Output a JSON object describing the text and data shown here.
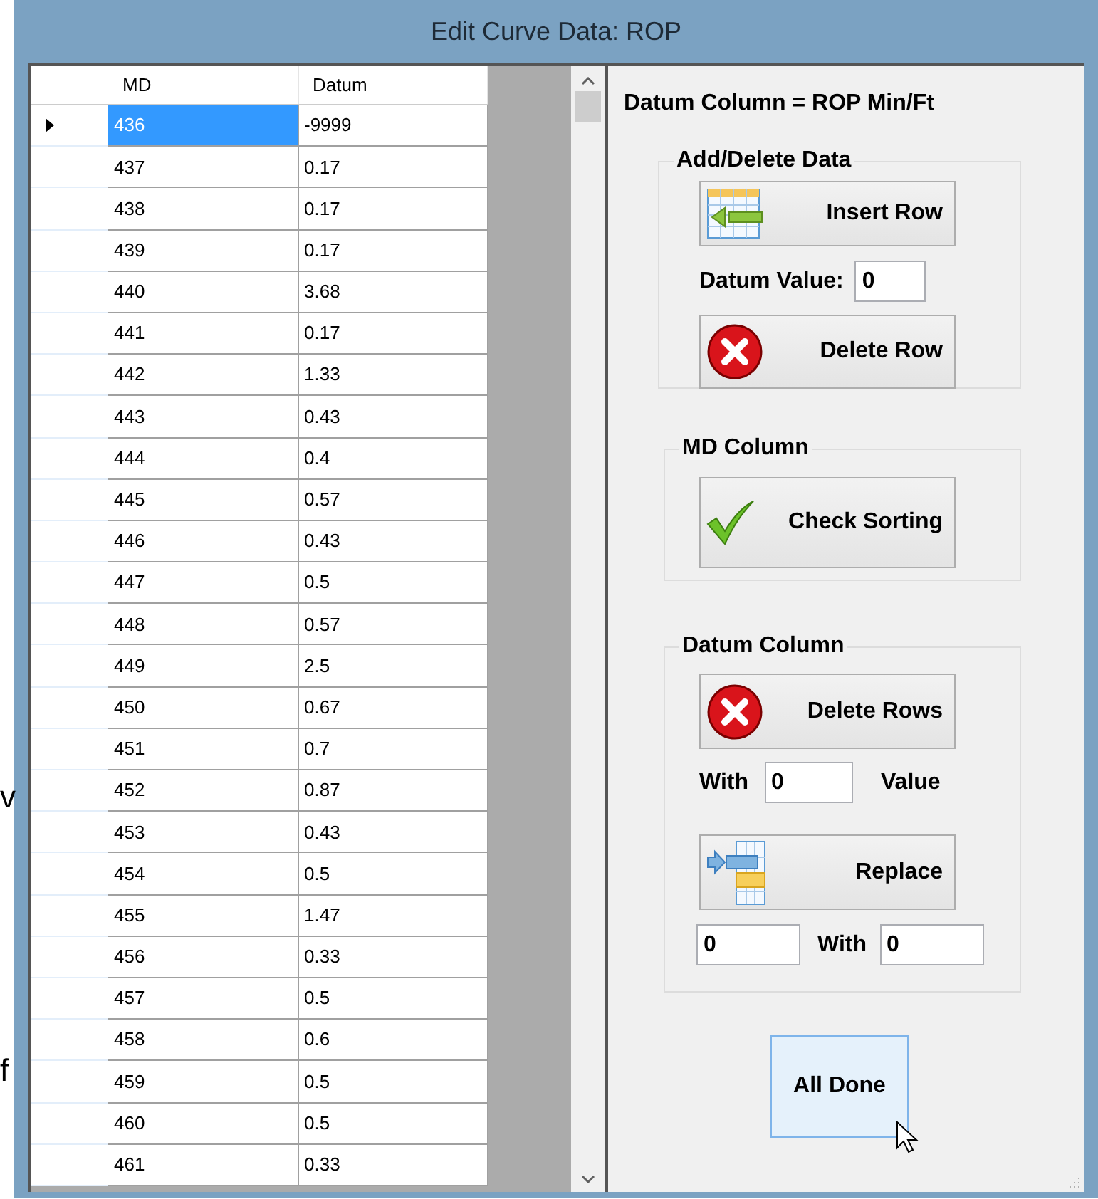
{
  "background_text": [
    "v",
    "f"
  ],
  "window": {
    "title": "Edit Curve Data: ROP"
  },
  "grid": {
    "columns": [
      "MD",
      "Datum"
    ],
    "rows": [
      {
        "md": "436",
        "datum": "-9999",
        "selected": true
      },
      {
        "md": "437",
        "datum": "0.17",
        "selected": false
      },
      {
        "md": "438",
        "datum": "0.17",
        "selected": false
      },
      {
        "md": "439",
        "datum": "0.17",
        "selected": false
      },
      {
        "md": "440",
        "datum": "3.68",
        "selected": false
      },
      {
        "md": "441",
        "datum": "0.17",
        "selected": false
      },
      {
        "md": "442",
        "datum": "1.33",
        "selected": false
      },
      {
        "md": "443",
        "datum": "0.43",
        "selected": false
      },
      {
        "md": "444",
        "datum": "0.4",
        "selected": false
      },
      {
        "md": "445",
        "datum": "0.57",
        "selected": false
      },
      {
        "md": "446",
        "datum": "0.43",
        "selected": false
      },
      {
        "md": "447",
        "datum": "0.5",
        "selected": false
      },
      {
        "md": "448",
        "datum": "0.57",
        "selected": false
      },
      {
        "md": "449",
        "datum": "2.5",
        "selected": false
      },
      {
        "md": "450",
        "datum": "0.67",
        "selected": false
      },
      {
        "md": "451",
        "datum": "0.7",
        "selected": false
      },
      {
        "md": "452",
        "datum": "0.87",
        "selected": false
      },
      {
        "md": "453",
        "datum": "0.43",
        "selected": false
      },
      {
        "md": "454",
        "datum": "0.5",
        "selected": false
      },
      {
        "md": "455",
        "datum": "1.47",
        "selected": false
      },
      {
        "md": "456",
        "datum": "0.33",
        "selected": false
      },
      {
        "md": "457",
        "datum": "0.5",
        "selected": false
      },
      {
        "md": "458",
        "datum": "0.6",
        "selected": false
      },
      {
        "md": "459",
        "datum": "0.5",
        "selected": false
      },
      {
        "md": "460",
        "datum": "0.5",
        "selected": false
      },
      {
        "md": "461",
        "datum": "0.33",
        "selected": false
      }
    ]
  },
  "panel": {
    "heading": "Datum Column = ROP Min/Ft",
    "add_delete": {
      "title": "Add/Delete Data",
      "insert_button": "Insert Row",
      "datum_label": "Datum Value:",
      "datum_value": "0",
      "delete_button": "Delete Row"
    },
    "md_column": {
      "title": "MD Column",
      "check_button": "Check Sorting"
    },
    "datum_column": {
      "title": "Datum Column",
      "delete_button": "Delete Rows",
      "with_label": "With",
      "with_value": "0",
      "value_label": "Value",
      "replace_button": "Replace",
      "replace_from": "0",
      "replace_with_label": "With",
      "replace_to": "0"
    },
    "done_button": {
      "label": "All Done",
      "hovered": true
    }
  }
}
